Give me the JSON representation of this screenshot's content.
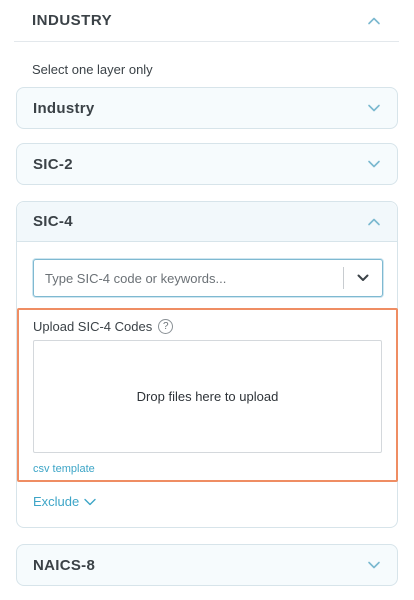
{
  "section": {
    "title": "INDUSTRY",
    "chevron": "chevron-up-icon"
  },
  "helper_text": "Select one layer only",
  "accordions": {
    "industry": {
      "label": "Industry",
      "chevron": "chevron-down-icon"
    },
    "sic2": {
      "label": "SIC-2",
      "chevron": "chevron-down-icon"
    },
    "sic4": {
      "label": "SIC-4",
      "chevron": "chevron-up-icon",
      "search_placeholder": "Type SIC-4 code or keywords...",
      "upload_label": "Upload SIC-4 Codes",
      "help_glyph": "?",
      "drop_text": "Drop files here to upload",
      "csv_link": "csv template",
      "exclude_label": "Exclude"
    },
    "naics8": {
      "label": "NAICS-8",
      "chevron": "chevron-down-icon"
    }
  },
  "colors": {
    "accent": "#3da5c7",
    "highlight_border": "#ef8d63",
    "chevron": "#7ab8cf"
  }
}
